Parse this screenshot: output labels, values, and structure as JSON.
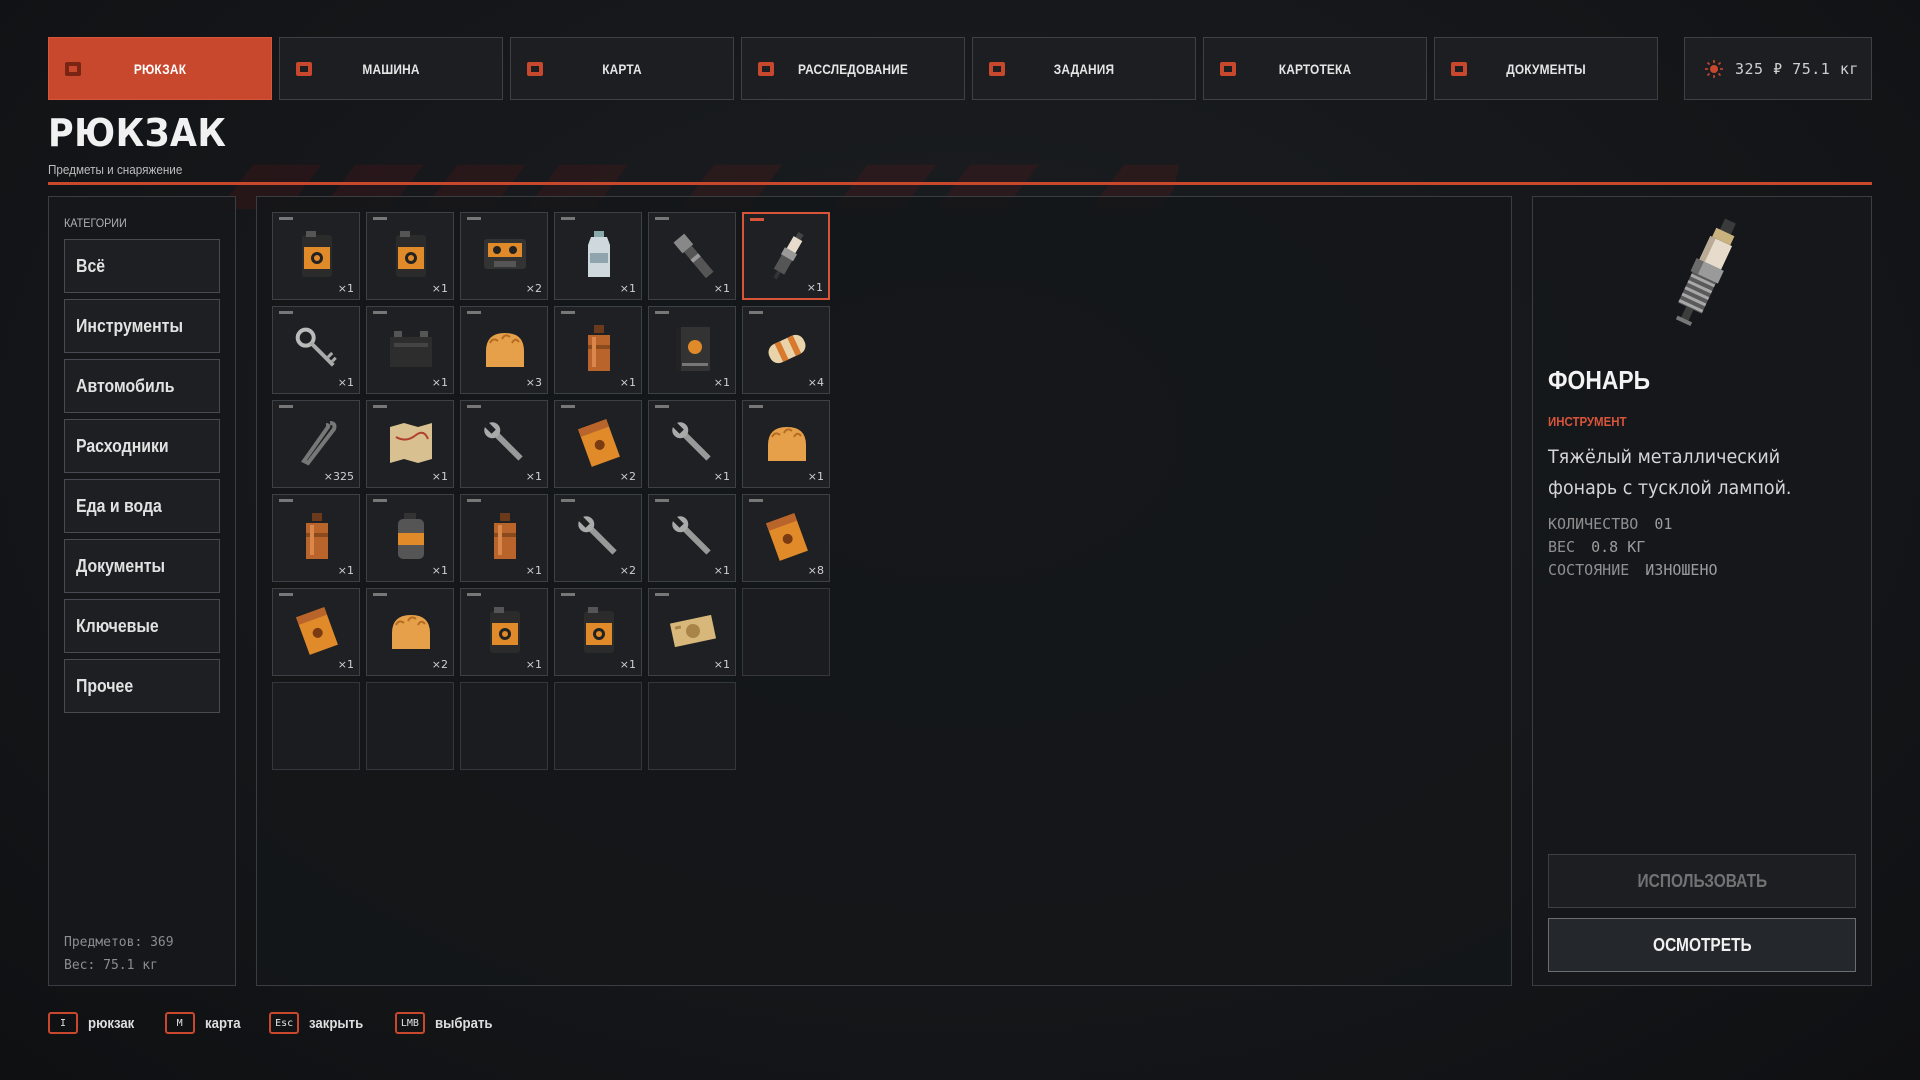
{
  "tabs": [
    {
      "label": "РЮКЗАК",
      "icon": "backpack-icon",
      "active": true
    },
    {
      "label": "МАШИНА",
      "icon": "car-icon",
      "active": false
    },
    {
      "label": "КАРТА",
      "icon": "map-icon",
      "active": false
    },
    {
      "label": "РАССЛЕДОВАНИЕ",
      "icon": "investigation-icon",
      "active": false
    },
    {
      "label": "ЗАДАНИЯ",
      "icon": "clipboard-icon",
      "active": false
    },
    {
      "label": "КАРТОТЕКА",
      "icon": "card-index-icon",
      "active": false
    },
    {
      "label": "ДОКУМЕНТЫ",
      "icon": "folder-icon",
      "active": false
    }
  ],
  "status": {
    "text": "325 ₽ 75.1 кг",
    "icon": "sun-icon"
  },
  "header": {
    "title": "РЮКЗАК",
    "subtitle": "Предметы и снаряжение"
  },
  "categories": {
    "heading": "КАТЕГОРИИ",
    "items": [
      "Всё",
      "Инструменты",
      "Автомобиль",
      "Расходники",
      "Еда и вода",
      "Документы",
      "Ключевые",
      "Прочее"
    ],
    "items_count": "Предметов: 369",
    "weight": "Вес: 75.1 кг"
  },
  "inventory": {
    "columns": 6,
    "slots": [
      {
        "icon": "canister",
        "qty": "×1"
      },
      {
        "icon": "canister",
        "qty": "×1"
      },
      {
        "icon": "cassette",
        "qty": "×2"
      },
      {
        "icon": "water-bottle",
        "qty": "×1"
      },
      {
        "icon": "flashlight",
        "qty": "×1"
      },
      {
        "icon": "spark-plug",
        "qty": "×1",
        "selected": true
      },
      {
        "icon": "key",
        "qty": "×1"
      },
      {
        "icon": "battery",
        "qty": "×1"
      },
      {
        "icon": "bread",
        "qty": "×3"
      },
      {
        "icon": "flask",
        "qty": "×1"
      },
      {
        "icon": "book",
        "qty": "×1"
      },
      {
        "icon": "bandage",
        "qty": "×4"
      },
      {
        "icon": "crowbar",
        "qty": "×325"
      },
      {
        "icon": "paper-map",
        "qty": "×1"
      },
      {
        "icon": "wrench",
        "qty": "×1"
      },
      {
        "icon": "cigarette-pack",
        "qty": "×2"
      },
      {
        "icon": "wrench",
        "qty": "×1"
      },
      {
        "icon": "bread",
        "qty": "×1"
      },
      {
        "icon": "flask",
        "qty": "×1"
      },
      {
        "icon": "fuel-can",
        "qty": "×1"
      },
      {
        "icon": "flask",
        "qty": "×1"
      },
      {
        "icon": "wrench",
        "qty": "×2"
      },
      {
        "icon": "wrench",
        "qty": "×1"
      },
      {
        "icon": "cigarette-pack",
        "qty": "×8"
      },
      {
        "icon": "cigarette-pack",
        "qty": "×1"
      },
      {
        "icon": "bread",
        "qty": "×2"
      },
      {
        "icon": "canister",
        "qty": "×1"
      },
      {
        "icon": "canister",
        "qty": "×1"
      },
      {
        "icon": "money",
        "qty": "×1"
      },
      {
        "icon": "empty"
      },
      {
        "icon": "empty"
      },
      {
        "icon": "empty"
      },
      {
        "icon": "empty"
      },
      {
        "icon": "empty"
      },
      {
        "icon": "empty"
      }
    ]
  },
  "detail": {
    "icon": "spark-plug",
    "title": "ФОНАРЬ",
    "type": "ИНСТРУМЕНТ",
    "description": "Тяжёлый металлический фонарь с тусклой лампой.",
    "stats": [
      {
        "label": "КОЛИЧЕСТВО",
        "value": "01"
      },
      {
        "label": "ВЕС",
        "value": "0.8 КГ"
      },
      {
        "label": "СОСТОЯНИЕ",
        "value": "ИЗНОШЕНО"
      }
    ],
    "use_label": "ИСПОЛЬЗОВАТЬ",
    "inspect_label": "ОСМОТРЕТЬ"
  },
  "hints": [
    {
      "key": "I",
      "label": "рюкзак"
    },
    {
      "key": "M",
      "label": "карта"
    },
    {
      "key": "Esc",
      "label": "закрыть"
    },
    {
      "key": "LMB",
      "label": "выбрать"
    }
  ],
  "colors": {
    "accent": "#c8482e",
    "panel": "#1c1e21",
    "border": "#3d4045"
  }
}
